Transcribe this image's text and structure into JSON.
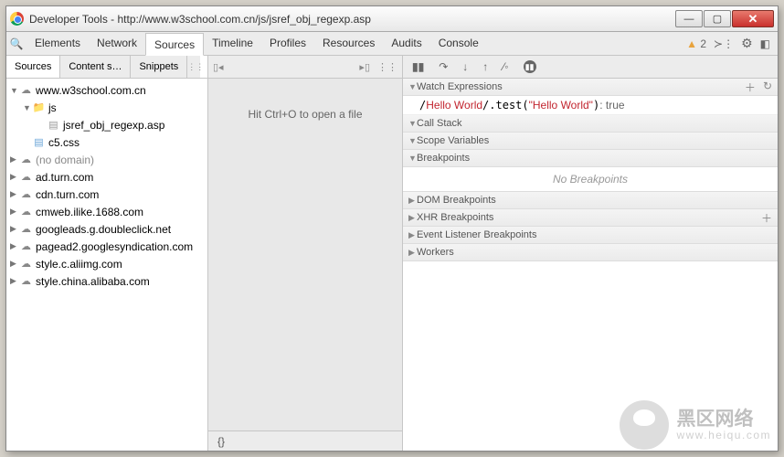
{
  "title": "Developer Tools - http://www.w3school.com.cn/js/jsref_obj_regexp.asp",
  "tabs": [
    "Elements",
    "Network",
    "Sources",
    "Timeline",
    "Profiles",
    "Resources",
    "Audits",
    "Console"
  ],
  "active_tab": "Sources",
  "warn_count": "2",
  "sub_tabs": [
    "Sources",
    "Content s…",
    "Snippets"
  ],
  "tree": {
    "root": "www.w3school.com.cn",
    "folder": "js",
    "file_js": "jsref_obj_regexp.asp",
    "file_css": "c5.css",
    "domains": [
      "(no domain)",
      "ad.turn.com",
      "cdn.turn.com",
      "cmweb.ilike.1688.com",
      "googleads.g.doubleclick.net",
      "pagead2.googlesyndication.com",
      "style.c.aliimg.com",
      "style.china.alibaba.com"
    ]
  },
  "mid_hint": "Hit Ctrl+O to open a file",
  "mid_foot": "{}",
  "debug_sections": {
    "watch": "Watch Expressions",
    "expr_code": "/Hello World/.test(\"Hello World\")",
    "expr_rgx": "Hello World",
    "expr_str": "\"Hello World\"",
    "expr_val": "true",
    "callstack": "Call Stack",
    "scope": "Scope Variables",
    "breakpoints": "Breakpoints",
    "no_bp": "No Breakpoints",
    "dom_bp": "DOM Breakpoints",
    "xhr_bp": "XHR Breakpoints",
    "ev_bp": "Event Listener Breakpoints",
    "workers": "Workers"
  },
  "watermark": {
    "line1": "黑区网络",
    "line2": "www.heiqu.com"
  }
}
